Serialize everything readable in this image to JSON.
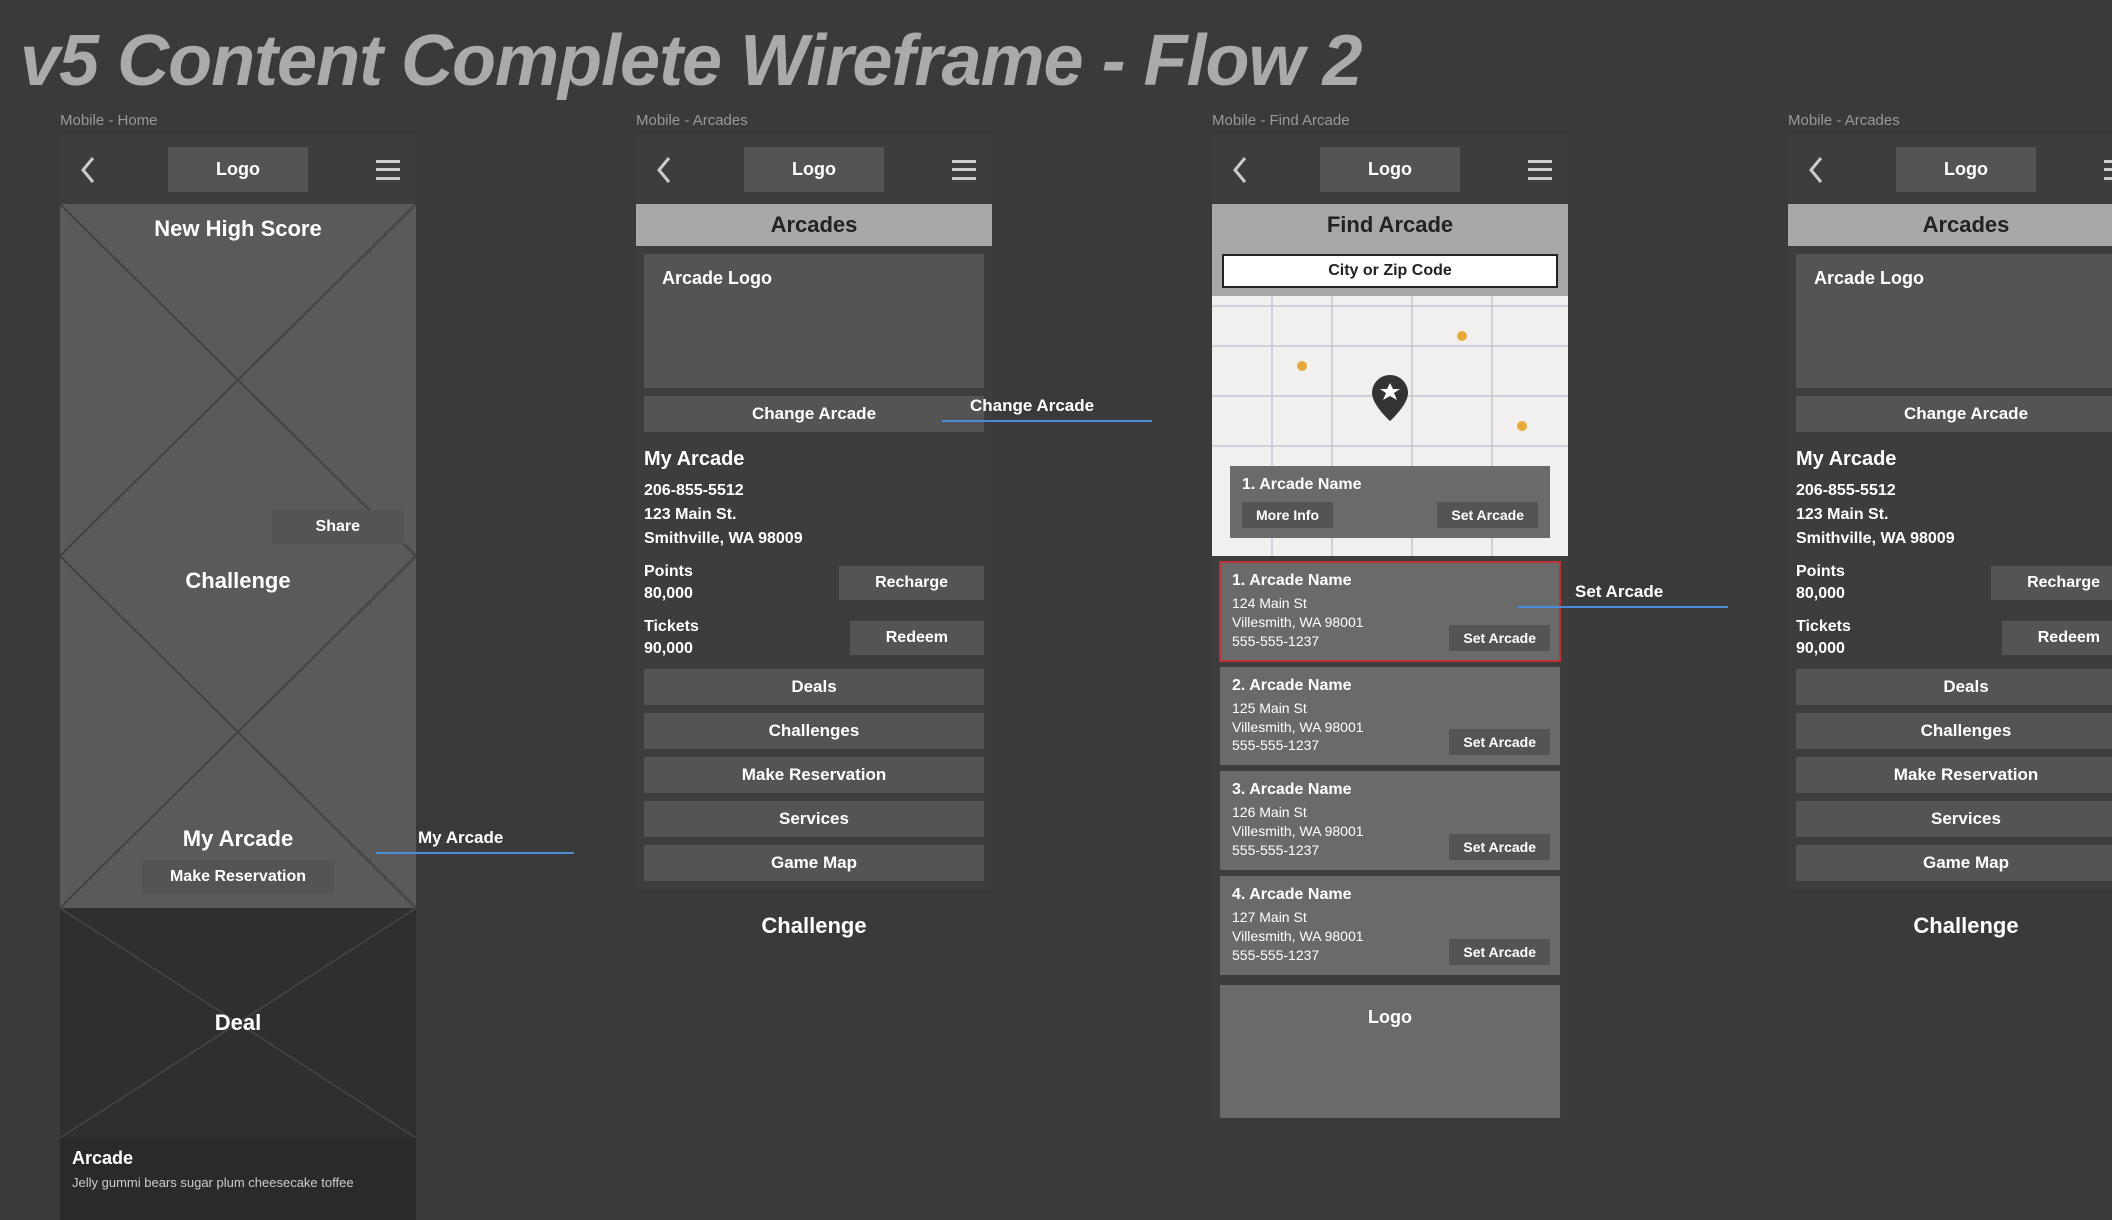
{
  "page_title": "v5 Content Complete Wireframe - Flow 2",
  "flow_links": {
    "my_arcade": "My Arcade",
    "change_arcade": "Change Arcade",
    "set_arcade": "Set Arcade"
  },
  "frames": {
    "home": {
      "label": "Mobile - Home",
      "logo": "Logo",
      "sections": {
        "highscore": {
          "title": "New High Score",
          "share": "Share"
        },
        "challenge": {
          "title": "Challenge"
        },
        "myarcade": {
          "title": "My Arcade",
          "make_reservation": "Make Reservation"
        },
        "deal": {
          "title": "Deal"
        },
        "arcade_footer": {
          "title": "Arcade",
          "body": "Jelly gummi bears sugar plum cheesecake toffee"
        }
      }
    },
    "arcades1": {
      "label": "Mobile - Arcades",
      "logo": "Logo",
      "banner": "Arcades",
      "arcade_logo": "Arcade Logo",
      "change_arcade": "Change Arcade",
      "my_arcade": "My Arcade",
      "phone_num": "206-855-5512",
      "addr1": "123 Main St.",
      "addr2": "Smithville, WA 98009",
      "points_label": "Points",
      "points_value": "80,000",
      "tickets_label": "Tickets",
      "tickets_value": "90,000",
      "recharge": "Recharge",
      "redeem": "Redeem",
      "buttons": {
        "deals": "Deals",
        "challenges": "Challenges",
        "make_reservation": "Make Reservation",
        "services": "Services",
        "game_map": "Game Map"
      },
      "challenge_sub": "Challenge"
    },
    "find": {
      "label": "Mobile - Find Arcade",
      "logo": "Logo",
      "banner": "Find Arcade",
      "search_placeholder": "City or Zip Code",
      "map_pop": {
        "title": "1. Arcade Name",
        "more_info": "More Info",
        "set_arcade": "Set Arcade"
      },
      "results": [
        {
          "title": "1. Arcade Name",
          "addr": "124 Main St",
          "city": "Villesmith, WA 98001",
          "phone": "555-555-1237",
          "set": "Set Arcade"
        },
        {
          "title": "2. Arcade Name",
          "addr": "125 Main St",
          "city": "Villesmith, WA 98001",
          "phone": "555-555-1237",
          "set": "Set Arcade"
        },
        {
          "title": "3. Arcade Name",
          "addr": "126 Main St",
          "city": "Villesmith, WA 98001",
          "phone": "555-555-1237",
          "set": "Set Arcade"
        },
        {
          "title": "4. Arcade Name",
          "addr": "127 Main St",
          "city": "Villesmith, WA 98001",
          "phone": "555-555-1237",
          "set": "Set Arcade"
        }
      ],
      "footer_logo": "Logo"
    },
    "arcades2": {
      "label": "Mobile - Arcades",
      "logo": "Logo",
      "banner": "Arcades",
      "arcade_logo": "Arcade Logo",
      "change_arcade": "Change Arcade",
      "my_arcade": "My Arcade",
      "phone_num": "206-855-5512",
      "addr1": "123 Main St.",
      "addr2": "Smithville, WA 98009",
      "points_label": "Points",
      "points_value": "80,000",
      "tickets_label": "Tickets",
      "tickets_value": "90,000",
      "recharge": "Recharge",
      "redeem": "Redeem",
      "buttons": {
        "deals": "Deals",
        "challenges": "Challenges",
        "make_reservation": "Make Reservation",
        "services": "Services",
        "game_map": "Game Map"
      },
      "challenge_sub": "Challenge"
    }
  }
}
